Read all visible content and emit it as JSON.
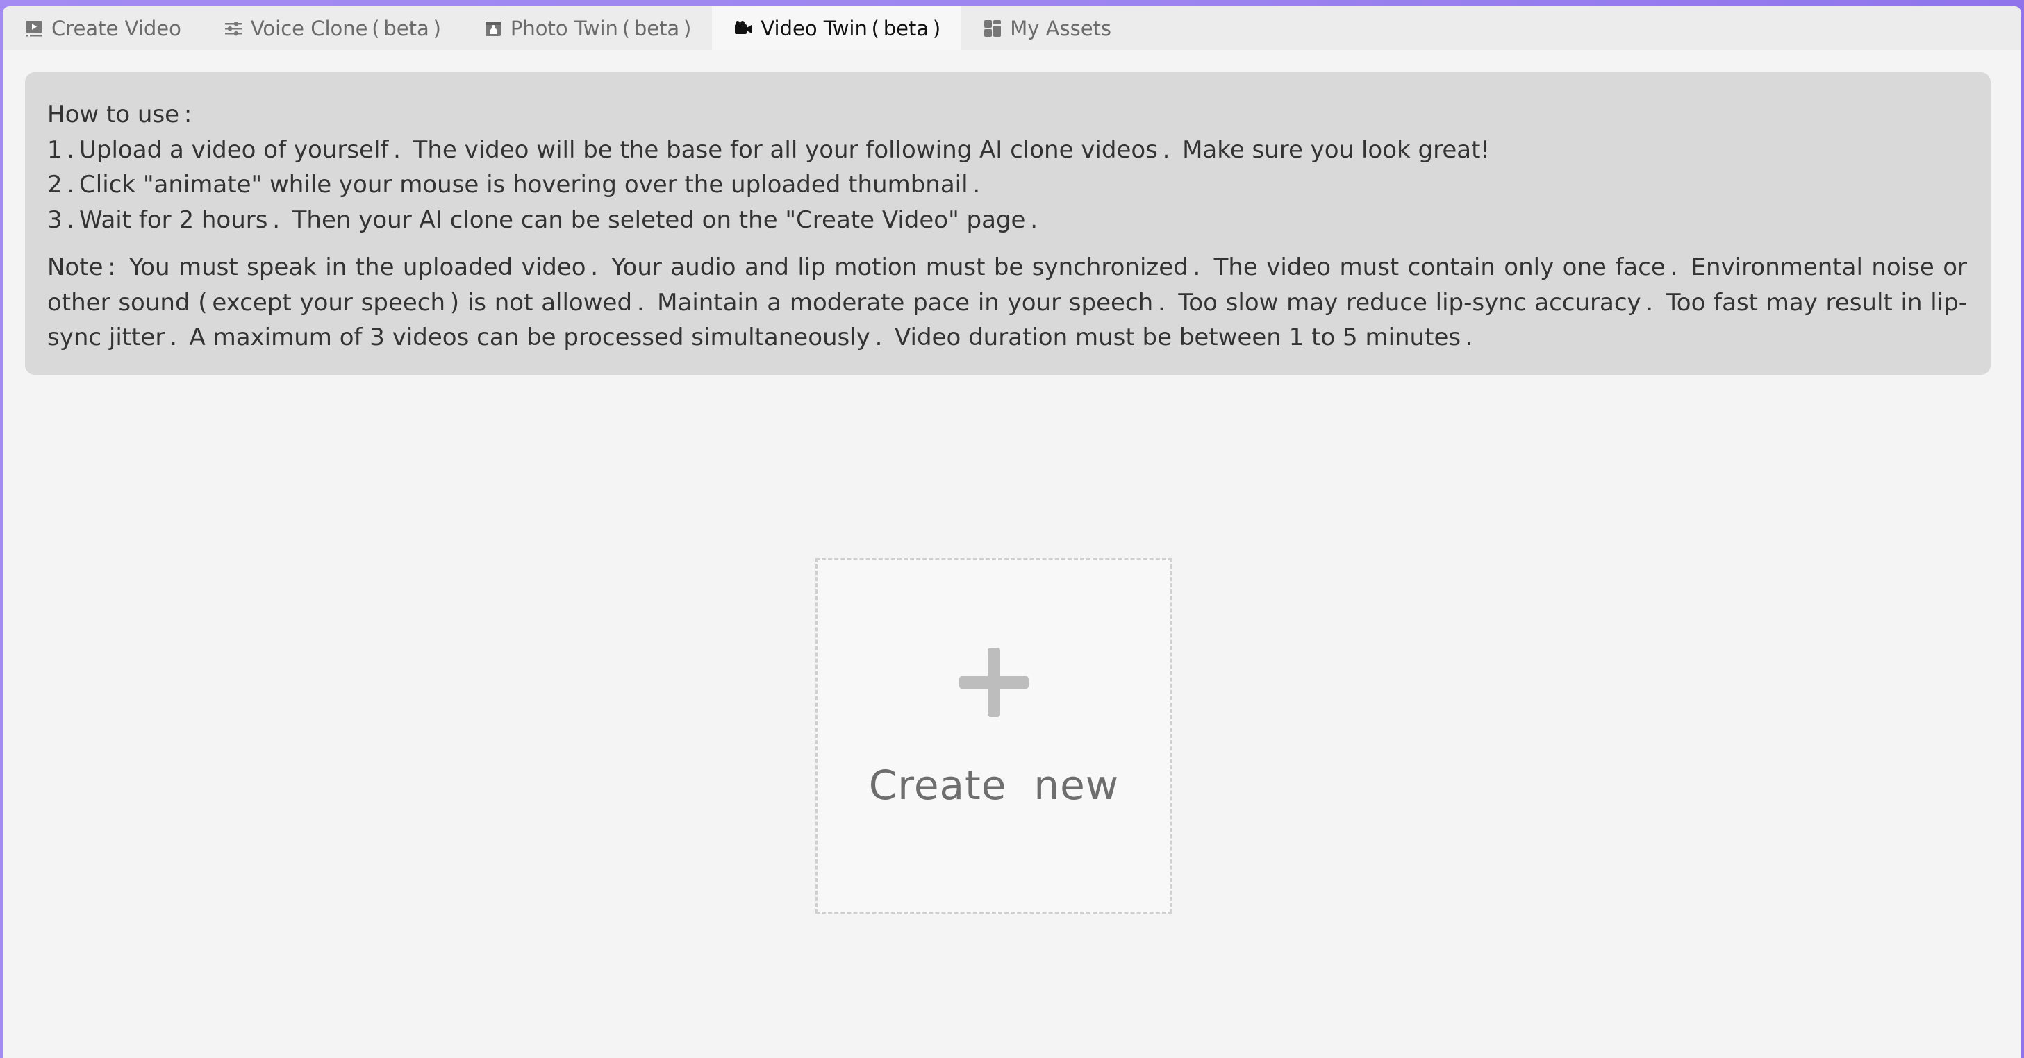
{
  "tabs": [
    {
      "label": "Create Video",
      "icon": "play-screen-icon",
      "active": false
    },
    {
      "label": "Voice Clone ( beta )",
      "icon": "sliders-icon",
      "active": false
    },
    {
      "label": "Photo Twin ( beta )",
      "icon": "photo-icon",
      "active": false
    },
    {
      "label": "Video Twin ( beta )",
      "icon": "video-camera-icon",
      "active": true
    },
    {
      "label": "My Assets",
      "icon": "grid-icon",
      "active": false
    }
  ],
  "instructions": {
    "heading": "How to use :",
    "steps": [
      "1 . Upload a video of yourself .  The video will be the base for all your following AI clone videos .  Make sure you look great!",
      "2 . Click \"animate\" while your mouse is hovering over the uploaded thumbnail .",
      "3 . Wait for 2 hours .  Then your AI clone can be seleted on the \"Create Video\" page ."
    ],
    "note": "Note :  You must speak in the uploaded video .  Your audio and lip motion must be synchronized .  The video must contain only one face .  Environmental noise or other sound ( except your speech ) is not allowed .  Maintain a moderate pace in your speech .  Too slow may reduce lip-sync accuracy .  Too fast may result in lip-sync jitter .  A maximum of 3 videos can be processed simultaneously .  Video duration must be between 1 to 5 minutes ."
  },
  "create_card": {
    "label": "Create  new",
    "icon": "plus-icon"
  },
  "colors": {
    "accent_bar": "#9e86f0",
    "tab_active_text": "#111111",
    "tab_text": "#6b6b6b",
    "info_bg": "#d9d9d9"
  }
}
